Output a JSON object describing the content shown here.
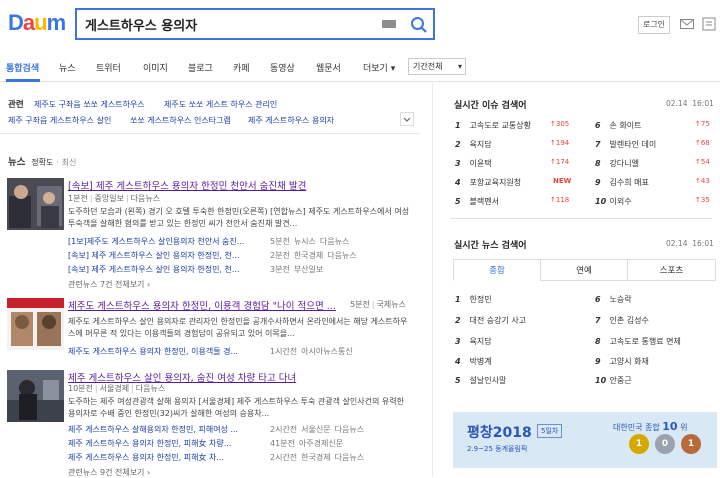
{
  "header": {
    "logo_letters": [
      {
        "ch": "D",
        "color": "#3c75e0"
      },
      {
        "ch": "a",
        "color": "#e6463c"
      },
      {
        "ch": "u",
        "color": "#ffb400"
      },
      {
        "ch": "m",
        "color": "#3c75e0"
      }
    ],
    "search_value": "게스트하우스 용의자",
    "login_label": "로그인"
  },
  "tabs": {
    "items": [
      "통합검색",
      "뉴스",
      "트위터",
      "이미지",
      "블로그",
      "카페",
      "동영상",
      "웹문서"
    ],
    "more_label": "더보기",
    "period_label": "기간전체"
  },
  "related": {
    "label": "관련",
    "links": [
      "제주도 구좌읍 쏘쏘 게스트하우스",
      "제주도 쏘쏘 게스트 하우스 관리인",
      "제주 구좌읍 게스트하우스 살인",
      "쏘쏘 게스트하우스 인스타그램",
      "제주 게스트하우스 용의자"
    ]
  },
  "news": {
    "heading": "뉴스",
    "sort_accuracy": "정확도",
    "sort_sep": "·",
    "sort_latest": "최신",
    "articles": [
      {
        "title": "[속보] 제주 게스트하우스 용의자 한정민 천안서 숨진채 발견",
        "time": "1분전",
        "source": "중앙일보",
        "portal": "다음뉴스",
        "body": "도주하던 모습과 (왼쪽) 경기 오 호텔 투숙한 한정민(오른쪽) [연합뉴스] 제주도 게스트하우스에서 여성 투숙객을 살해한 혐의를 받고 있는 한정민 씨가 천안서 숨진채 발견...",
        "subs": [
          {
            "title": "[1보]제주도 게스트하우스 살인용의자 천안서 숨진...",
            "time": "5분전",
            "source": "뉴시스",
            "portal": "다음뉴스"
          },
          {
            "title": "[속보] 제주 게스트하우스 살인 용의자 한정민, 천...",
            "time": "2분전",
            "source": "한국경제",
            "portal": "다음뉴스"
          },
          {
            "title": "[속보] 제주 게스트하우스 살인 용의자 한정민, 천...",
            "time": "3분전",
            "source": "부산일보",
            "portal": ""
          }
        ],
        "more": "관련뉴스 7건 전체보기 ›"
      },
      {
        "title": "제주도 게스트하우스 용의자 한정민, 이용객 경험담 \"나이 적으면 ...",
        "time": "5분전",
        "source": "국제뉴스",
        "portal": "",
        "body": "제주도 게스트하우스 살인 용의자로 관리자인 한정민을 공개수사하면서 온라인에서는 해당 게스트하우스에 머무른 적 있다는 이용객들의 경험담이 공유되고 있어 이목을...",
        "subs": [
          {
            "title": "제주도 게스트하우스 용의자 한정민, 이용객들 경...",
            "time": "1시간전",
            "source": "아시아뉴스통신",
            "portal": ""
          }
        ],
        "more": ""
      },
      {
        "title": "제주 게스트하우스 살인 용의자, 숨진 여성 차량 타고 다녀",
        "time": "10분전",
        "source": "서울경제",
        "portal": "다음뉴스",
        "body": "도주하는 제주 여성관광객 살해 용의자 [서울경제] 제주 게스트하우스 투숙 관광객 살인사건의 유력한 용의자로 수배 중인 한정민(32)씨가 살해한 여성의 승용차...",
        "subs": [
          {
            "title": "제주 게스트하우스 살해용의자 한정민, 피해여성 ...",
            "time": "2시간전",
            "source": "서울신문",
            "portal": "다음뉴스"
          },
          {
            "title": "제주 게스트하우스 용의자 한정민, 피해女 차량...",
            "time": "41분전",
            "source": "아주경제신문",
            "portal": ""
          },
          {
            "title": "제주 게스트하우스 용의자 한정민, 피해女 차...",
            "time": "2시간전",
            "source": "한국경제",
            "portal": "다음뉴스"
          }
        ],
        "more": "관련뉴스 9건 전체보기 ›"
      }
    ]
  },
  "realtime_issues": {
    "title": "실시간 이슈 검색어",
    "date": "02.14",
    "time": "16:01",
    "items": [
      {
        "rank": "1",
        "label": "고속도로 교통상황",
        "delta": "↑305"
      },
      {
        "rank": "2",
        "label": "육지담",
        "delta": "↑194"
      },
      {
        "rank": "3",
        "label": "이윤택",
        "delta": "↑174"
      },
      {
        "rank": "4",
        "label": "포항교육지원청",
        "delta": "NEW"
      },
      {
        "rank": "5",
        "label": "블랙펜서",
        "delta": "↑118"
      },
      {
        "rank": "6",
        "label": "손 화이트",
        "delta": "↑75"
      },
      {
        "rank": "7",
        "label": "발렌타인 데이",
        "delta": "↑68"
      },
      {
        "rank": "8",
        "label": "강다니엘",
        "delta": "↑54"
      },
      {
        "rank": "9",
        "label": "김수희 매표",
        "delta": "↑43"
      },
      {
        "rank": "10",
        "label": "이외수",
        "delta": "↑35"
      }
    ]
  },
  "realtime_news": {
    "title": "실시간 뉴스 검색어",
    "date": "02.14",
    "time": "16:01",
    "tabs": [
      "종합",
      "연예",
      "스포츠"
    ],
    "items": [
      {
        "rank": "1",
        "label": "한정민"
      },
      {
        "rank": "2",
        "label": "대전 승강기 사고"
      },
      {
        "rank": "3",
        "label": "육지담"
      },
      {
        "rank": "4",
        "label": "박병계"
      },
      {
        "rank": "5",
        "label": "설날인사말"
      },
      {
        "rank": "6",
        "label": "노승락"
      },
      {
        "rank": "7",
        "label": "인촌 김성수"
      },
      {
        "rank": "8",
        "label": "고속도로 통행료 면제"
      },
      {
        "rank": "9",
        "label": "고양시 화재"
      },
      {
        "rank": "10",
        "label": "안중근"
      }
    ]
  },
  "banner": {
    "title": "평창2018",
    "day": "5일차",
    "dates": "2.9~25 동계올림픽",
    "rank_label": "대한민국 종합",
    "rank_value": "10",
    "rank_unit": "위",
    "medals": [
      {
        "count": "1",
        "color": "#d6a800"
      },
      {
        "count": "0",
        "color": "#9aa3ad"
      },
      {
        "count": "1",
        "color": "#b86a3a"
      }
    ]
  }
}
